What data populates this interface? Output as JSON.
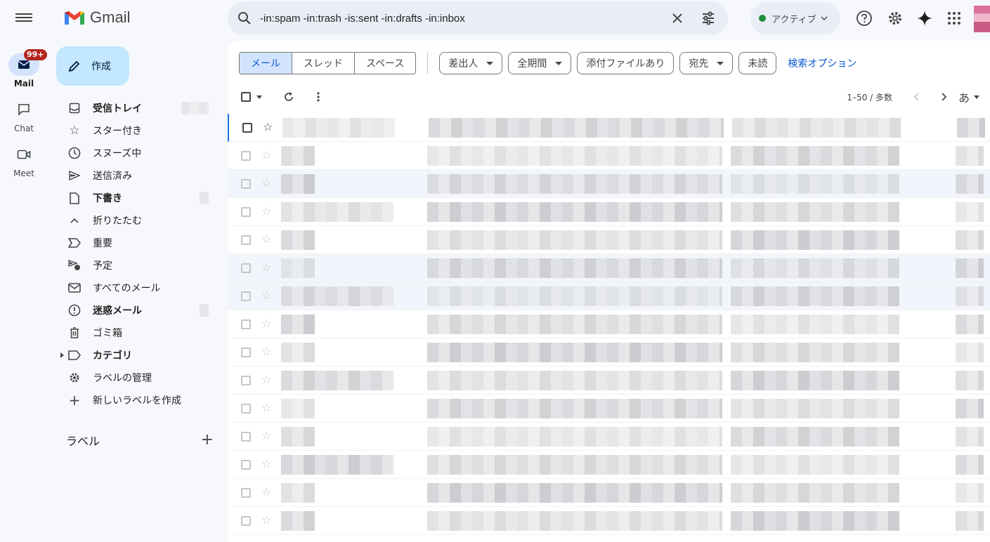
{
  "rail": {
    "items": [
      {
        "label": "Mail",
        "badge": "99+"
      },
      {
        "label": "Chat"
      },
      {
        "label": "Meet"
      }
    ]
  },
  "brand": {
    "name": "Gmail"
  },
  "compose": {
    "label": "作成"
  },
  "nav": {
    "items": [
      {
        "label": "受信トレイ"
      },
      {
        "label": "スター付き"
      },
      {
        "label": "スヌーズ中"
      },
      {
        "label": "送信済み"
      },
      {
        "label": "下書き"
      },
      {
        "label": "折りたたむ"
      },
      {
        "label": "重要"
      },
      {
        "label": "予定"
      },
      {
        "label": "すべてのメール"
      },
      {
        "label": "迷惑メール"
      },
      {
        "label": "ゴミ箱"
      },
      {
        "label": "カテゴリ"
      },
      {
        "label": "ラベルの管理"
      },
      {
        "label": "新しいラベルを作成"
      }
    ]
  },
  "labels_section": {
    "title": "ラベル"
  },
  "search": {
    "query": "-in:spam -in:trash -is:sent -in:drafts -in:inbox"
  },
  "status": {
    "label": "アクティブ",
    "color": "#1e8e3e"
  },
  "filters": {
    "segments": [
      "メール",
      "スレッド",
      "スペース"
    ],
    "chips": [
      {
        "label": "差出人",
        "dropdown": true
      },
      {
        "label": "全期間",
        "dropdown": true
      },
      {
        "label": "添付ファイルあり",
        "dropdown": false
      },
      {
        "label": "宛先",
        "dropdown": true
      },
      {
        "label": "未読",
        "dropdown": false
      }
    ],
    "advanced": "検索オプション"
  },
  "toolbar": {
    "pagination": "1–50 / 多数",
    "input_tool": "あ"
  },
  "colors": {
    "accent": "#0b57d0",
    "compose_bg": "#c2e7ff",
    "selected_bg": "#d3e3fd",
    "badge": "#b3261e"
  }
}
